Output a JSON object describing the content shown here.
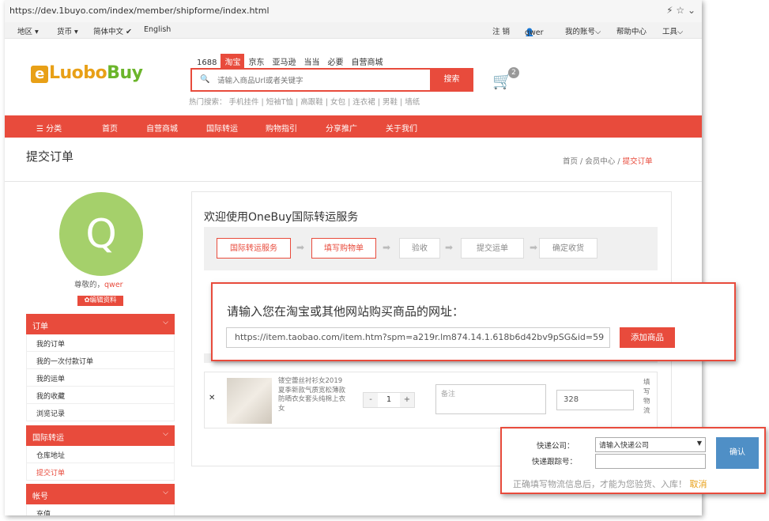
{
  "browser": {
    "url": "https://dev.1buyo.com/index/member/shipforme/index.html",
    "icons": [
      "bolt-icon",
      "star-icon",
      "chevron-down-icon"
    ]
  },
  "topbar": {
    "region": "地区 ▾",
    "currency": "货币 ▾",
    "lang_zh": "简体中文 ✔",
    "lang_en": "English",
    "logout": "注 销",
    "user": "qwer",
    "account": "我的账号⌵",
    "help": "帮助中心",
    "tools": "工具⌵"
  },
  "header": {
    "logo_box": "e",
    "logo_mid": "Luobo",
    "logo_buy": "Buy",
    "shop_tabs": [
      "1688",
      "淘宝",
      "京东",
      "亚马逊",
      "当当",
      "必要",
      "自营商城"
    ],
    "search_placeholder": "请输入商品Url或者关键字",
    "search_button": "搜索",
    "hot_words": "热门搜索： 手机挂件 | 短袖T恤 | 高跟鞋 | 女包 | 连衣裙 | 男鞋 | 墙纸",
    "cart_count": "2"
  },
  "nav": [
    "☰ 分类",
    "首页",
    "自营商城",
    "国际转运",
    "购物指引",
    "分享推广",
    "关于我们"
  ],
  "page": {
    "title": "提交订单",
    "crumb_home": "首页",
    "crumb_sep": "/",
    "crumb_member": "会员中心",
    "crumb_current": "提交订单"
  },
  "sidebar": {
    "avatar_letter": "Q",
    "greeting": "尊敬的，",
    "username": "qwer",
    "edit": "✿编辑资料",
    "groups": [
      {
        "title": "订单",
        "items": [
          "我的订单",
          "我的一次付款订单",
          "我的运单",
          "我的收藏",
          "浏览记录"
        ]
      },
      {
        "title": "国际转运",
        "items": [
          "仓库地址",
          "提交订单"
        ]
      },
      {
        "title": "帐号",
        "items": [
          "充值"
        ]
      }
    ]
  },
  "main": {
    "welcome": "欢迎使用OneBuy国际转运服务",
    "steps": [
      "国际转运服务",
      "填写购物单",
      "验收",
      "提交运单",
      "确定收货"
    ],
    "product": {
      "title": "镂空蕾丝衬衫女2019夏季新款气质宽松薄款防晒衣女套头纯棉上衣女",
      "qty": "1",
      "note_placeholder": "备注",
      "price": "328",
      "tail": "填写物流"
    }
  },
  "url_popup": {
    "label": "请输入您在淘宝或其他网站购买商品的网址：",
    "url_value": "https://item.taobao.com/item.htm?spm=a219r.lm874.14.1.618b6d42bv9pSG&id=59",
    "add_button": "添加商品"
  },
  "ship_popup": {
    "company_label": "快递公司：",
    "company_placeholder": "请输入快递公司",
    "tracking_label": "快递跟踪号：",
    "confirm": "确认",
    "hint": "正确填写物流信息后，才能为您验货、入库！",
    "cancel": "取消"
  }
}
